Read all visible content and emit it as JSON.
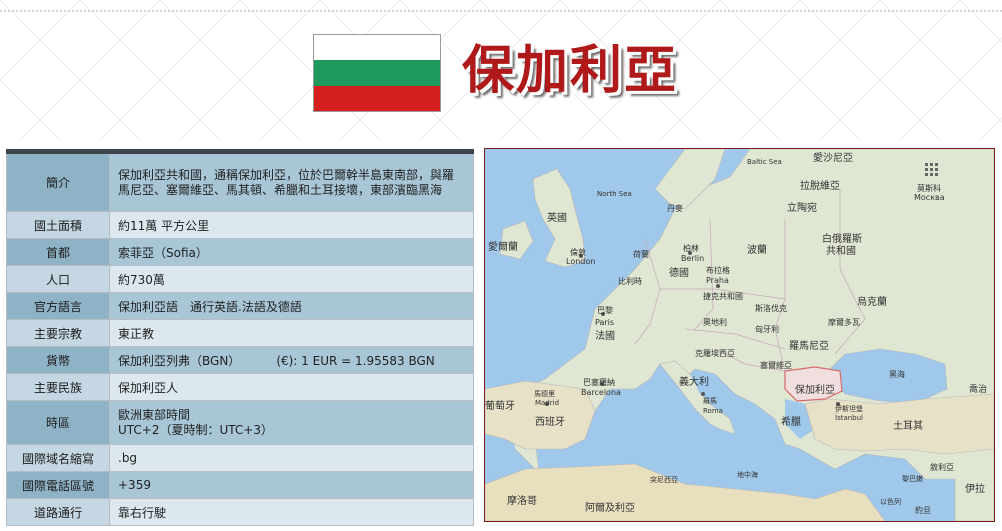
{
  "header": {
    "title": "保加利亞"
  },
  "flag": {
    "colors": [
      "#ffffff",
      "#1f9a5c",
      "#d41f1e"
    ]
  },
  "table": {
    "intro": {
      "label": "簡介",
      "value": "保加利亞共和國，通稱保加利亞，位於巴爾幹半島東南部，與羅馬尼亞、塞爾維亞、馬其頓、希臘和土耳接壞，東部濱臨黑海"
    },
    "area": {
      "label": "國土面積",
      "value": "約11萬 平方公里"
    },
    "capital": {
      "label": "首都",
      "value": "索菲亞（Sofia）"
    },
    "population": {
      "label": "人口",
      "value": "約730萬"
    },
    "language": {
      "label": "官方語言",
      "value": "保加利亞語　通行英語.法語及德語"
    },
    "religion": {
      "label": "主要宗教",
      "value": "東正教"
    },
    "currency": {
      "label": "貨幣",
      "value": "保加利亞列弗（BGN）",
      "value2": "(€): 1 EUR = 1.95583 BGN"
    },
    "ethnicity": {
      "label": "主要民族",
      "value": "保加利亞人"
    },
    "timezone": {
      "label": "時區",
      "line1": "歐洲東部時間",
      "line2": "UTC+2（夏時制：UTC+3）"
    },
    "tld": {
      "label": "國際域名縮寫",
      "value": ".bg"
    },
    "calling": {
      "label": "國際電話區號",
      "value": "+359"
    },
    "driving": {
      "label": "道路通行",
      "value": "靠右行駛"
    }
  },
  "map": {
    "labels": {
      "baltic": "Baltic Sea",
      "northsea": "North Sea",
      "latvia": "拉脫維亞",
      "estonia": "愛沙尼亞",
      "lithuania": "立陶宛",
      "moscow_zh": "莫斯科",
      "moscow": "Москва",
      "uk": "英國",
      "denmark": "丹麥",
      "ireland": "愛爾蘭",
      "london_zh": "倫敦",
      "london": "London",
      "nl": "荷蘭",
      "berlin_zh": "柏林",
      "berlin": "Berlin",
      "germany": "德國",
      "poland": "波蘭",
      "belarus1": "白俄羅斯",
      "belarus2": "共和國",
      "belgium": "比利時",
      "prague_zh": "布拉格",
      "prague": "Praha",
      "czech": "捷克共和國",
      "paris_zh": "巴黎",
      "paris": "Paris",
      "france": "法國",
      "slovakia": "斯洛伐克",
      "ukraine": "烏克蘭",
      "austria": "奧地利",
      "hungary": "匈牙利",
      "moldova": "摩爾多瓦",
      "romania": "羅馬尼亞",
      "croatia": "克羅埃西亞",
      "serbia": "塞爾維亞",
      "bulgaria": "保加利亞",
      "blacksea": "黑海",
      "madrid_zh": "馬德里",
      "madrid": "Madrid",
      "barcelona_zh": "巴塞羅納",
      "barcelona": "Barcelona",
      "portugal": "葡萄牙",
      "spain": "西班牙",
      "italy": "義大利",
      "rome_zh": "羅馬",
      "rome": "Roma",
      "istanbul_zh": "伊斯坦堡",
      "istanbul": "İstanbul",
      "greece": "希臘",
      "turkey": "土耳其",
      "georgia": "喬治",
      "tunisia": "突尼西亞",
      "med": "地中海",
      "syria": "敘利亞",
      "lebanon": "黎巴嫩",
      "morocco": "摩洛哥",
      "algeria": "阿爾及利亞",
      "israel": "以色列",
      "iraq": "伊拉",
      "jordan": "約旦"
    }
  }
}
